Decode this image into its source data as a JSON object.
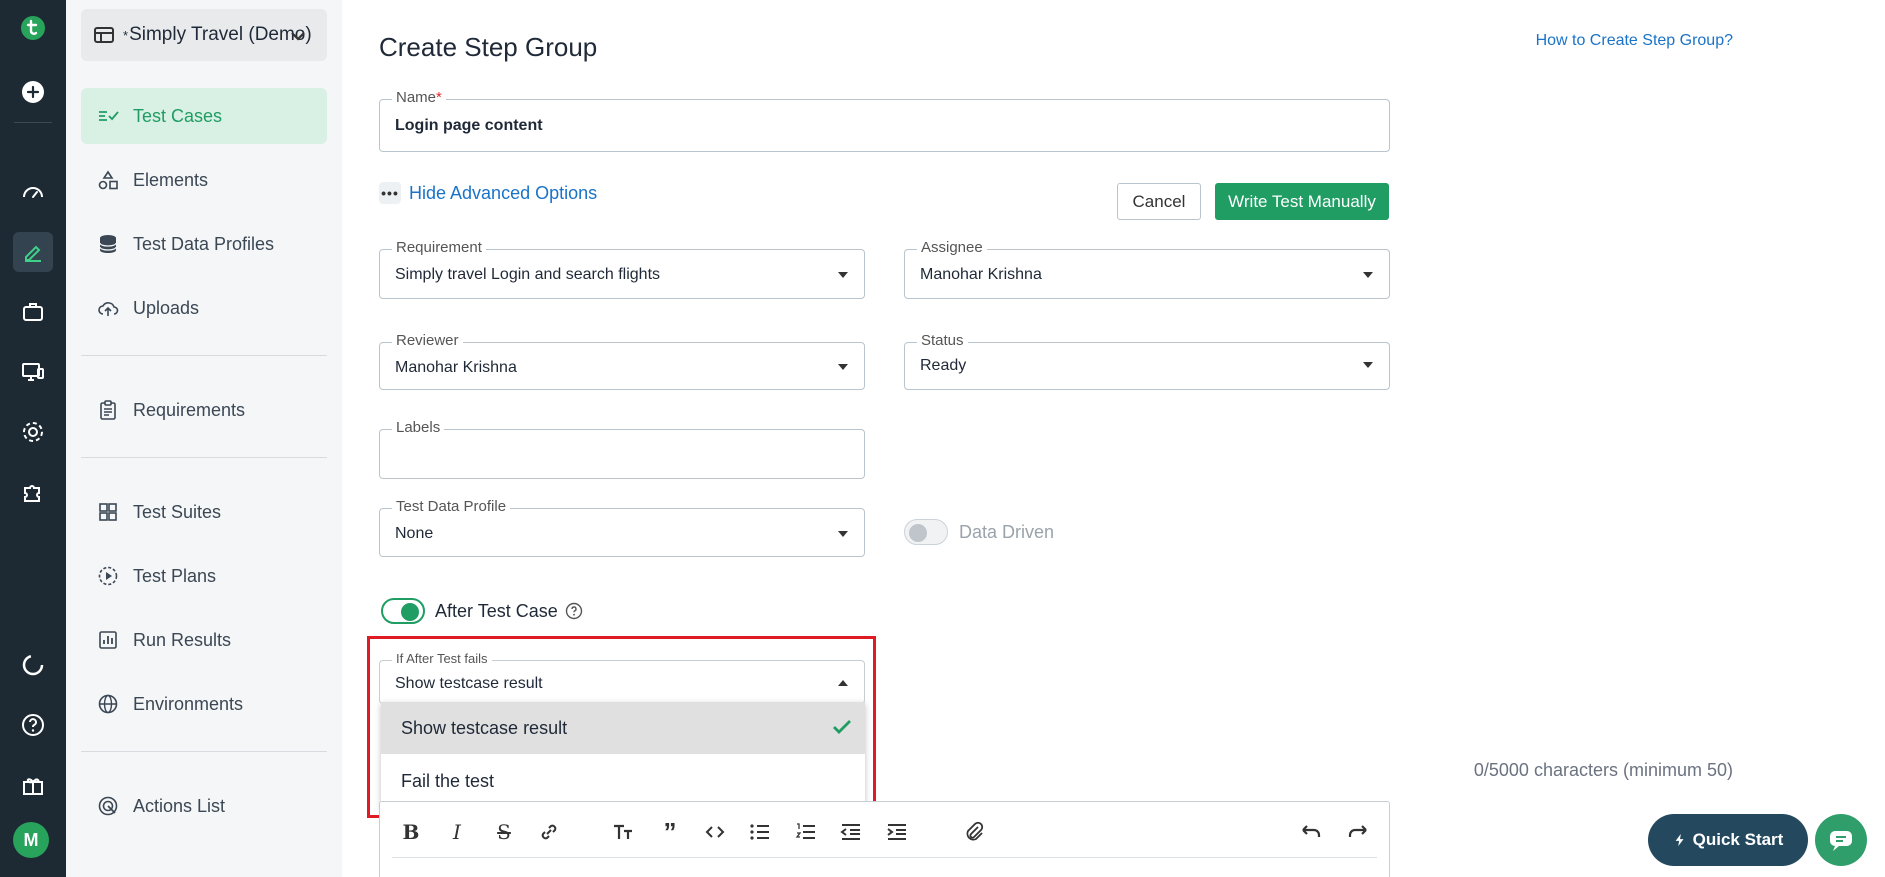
{
  "colors": {
    "rail": "#1e2a33",
    "accent_green": "#1f9d63",
    "link_blue": "#1a73c8",
    "highlight_red": "#e01b24"
  },
  "rail": {
    "icons": [
      "logo-icon",
      "add-icon",
      "dashboard-icon",
      "edit-icon",
      "briefcase-icon",
      "monitor-icon",
      "settings-icon",
      "puzzle-icon",
      "loader-icon",
      "help-icon",
      "gift-icon"
    ],
    "avatar": "M"
  },
  "sidebar": {
    "project_prefix": "*",
    "project_name": "Simply Travel (Demo)",
    "items": [
      {
        "label": "Test Cases",
        "icon": "test-cases-icon"
      },
      {
        "label": "Elements",
        "icon": "elements-icon"
      },
      {
        "label": "Test Data Profiles",
        "icon": "database-icon"
      },
      {
        "label": "Uploads",
        "icon": "cloud-upload-icon"
      },
      {
        "label": "Requirements",
        "icon": "clipboard-icon"
      },
      {
        "label": "Test Suites",
        "icon": "grid-icon"
      },
      {
        "label": "Test Plans",
        "icon": "play-circle-icon"
      },
      {
        "label": "Run Results",
        "icon": "bar-chart-icon"
      },
      {
        "label": "Environments",
        "icon": "globe-icon"
      },
      {
        "label": "Actions List",
        "icon": "radar-icon"
      }
    ]
  },
  "main": {
    "title": "Create Step Group",
    "help_link": "How to Create Step Group?",
    "name_label": "Name",
    "name_required_mark": "*",
    "name_value": "Login page content",
    "advanced_toggle": "Hide Advanced Options",
    "cancel_label": "Cancel",
    "write_label": "Write Test Manually",
    "requirement_label": "Requirement",
    "requirement_value": "Simply travel Login and search flights",
    "assignee_label": "Assignee",
    "assignee_value": "Manohar Krishna",
    "reviewer_label": "Reviewer",
    "reviewer_value": "Manohar Krishna",
    "status_label": "Status",
    "status_value": "Ready",
    "labels_label": "Labels",
    "labels_value": "",
    "tdp_label": "Test Data Profile",
    "tdp_value": "None",
    "data_driven_label": "Data Driven",
    "data_driven_on": false,
    "after_test_label": "After Test Case",
    "after_test_on": true,
    "if_fails_label": "If After Test fails",
    "if_fails_value": "Show testcase result",
    "if_fails_options": [
      {
        "label": "Show testcase result",
        "selected": true
      },
      {
        "label": "Fail the test",
        "selected": false
      }
    ],
    "char_count": "0/5000 characters (minimum 50)"
  },
  "editor_toolbar": [
    "bold-icon",
    "italic-icon",
    "strikethrough-icon",
    "link-icon",
    "heading-icon",
    "quote-icon",
    "code-icon",
    "bullet-list-icon",
    "numbered-list-icon",
    "outdent-icon",
    "indent-icon",
    "attachment-icon",
    "undo-icon",
    "redo-icon"
  ],
  "quick_start_label": "Quick Start"
}
